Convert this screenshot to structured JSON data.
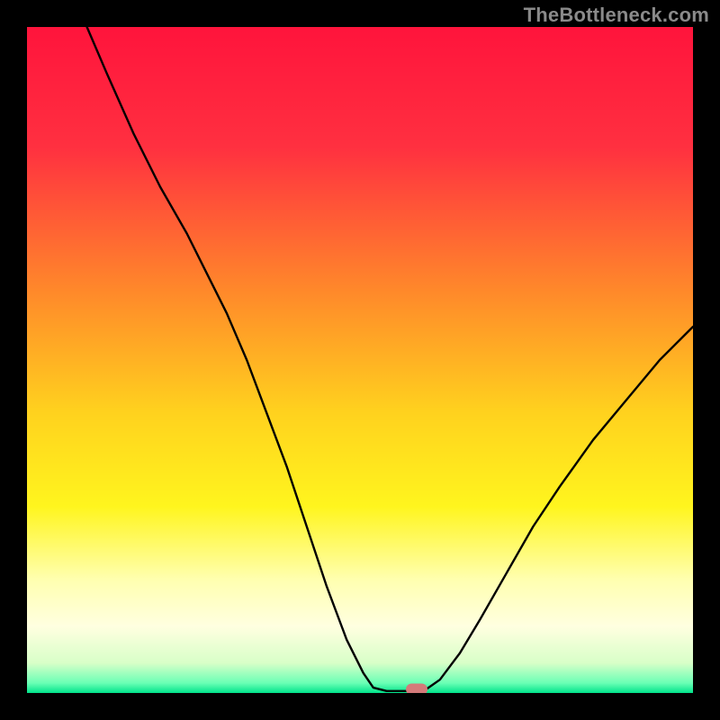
{
  "watermark": "TheBottleneck.com",
  "colors": {
    "marker": "#d47a7a",
    "curve": "#000000",
    "frame": "#000000",
    "gradient_stops": [
      {
        "pos": 0.0,
        "color": "#ff143c"
      },
      {
        "pos": 0.18,
        "color": "#ff3040"
      },
      {
        "pos": 0.4,
        "color": "#ff8a2a"
      },
      {
        "pos": 0.58,
        "color": "#ffd21e"
      },
      {
        "pos": 0.72,
        "color": "#fff51e"
      },
      {
        "pos": 0.83,
        "color": "#ffffb0"
      },
      {
        "pos": 0.9,
        "color": "#ffffe0"
      },
      {
        "pos": 0.955,
        "color": "#d8ffc8"
      },
      {
        "pos": 0.985,
        "color": "#6affb5"
      },
      {
        "pos": 1.0,
        "color": "#00e38a"
      }
    ]
  },
  "chart_data": {
    "type": "line",
    "title": "",
    "xlabel": "",
    "ylabel": "",
    "xlim": [
      0,
      100
    ],
    "ylim": [
      0,
      100
    ],
    "curve_points": [
      {
        "x": 9.0,
        "y": 100.0
      },
      {
        "x": 12.0,
        "y": 93.0
      },
      {
        "x": 16.0,
        "y": 84.0
      },
      {
        "x": 20.0,
        "y": 76.0
      },
      {
        "x": 24.0,
        "y": 69.0
      },
      {
        "x": 27.0,
        "y": 63.0
      },
      {
        "x": 30.0,
        "y": 57.0
      },
      {
        "x": 33.0,
        "y": 50.0
      },
      {
        "x": 36.0,
        "y": 42.0
      },
      {
        "x": 39.0,
        "y": 34.0
      },
      {
        "x": 42.0,
        "y": 25.0
      },
      {
        "x": 45.0,
        "y": 16.0
      },
      {
        "x": 48.0,
        "y": 8.0
      },
      {
        "x": 50.5,
        "y": 3.0
      },
      {
        "x": 52.0,
        "y": 0.8
      },
      {
        "x": 54.0,
        "y": 0.3
      },
      {
        "x": 56.5,
        "y": 0.3
      },
      {
        "x": 58.0,
        "y": 0.3
      },
      {
        "x": 60.0,
        "y": 0.6
      },
      {
        "x": 62.0,
        "y": 2.0
      },
      {
        "x": 65.0,
        "y": 6.0
      },
      {
        "x": 68.0,
        "y": 11.0
      },
      {
        "x": 72.0,
        "y": 18.0
      },
      {
        "x": 76.0,
        "y": 25.0
      },
      {
        "x": 80.0,
        "y": 31.0
      },
      {
        "x": 85.0,
        "y": 38.0
      },
      {
        "x": 90.0,
        "y": 44.0
      },
      {
        "x": 95.0,
        "y": 50.0
      },
      {
        "x": 100.0,
        "y": 55.0
      }
    ],
    "marker": {
      "x": 58.5,
      "y": 0.5
    }
  }
}
